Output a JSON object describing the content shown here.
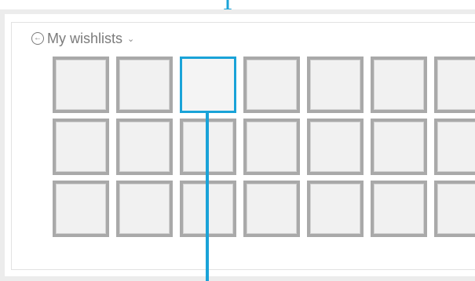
{
  "wishlists": {
    "back_icon": "circle-arrow-left-icon",
    "title": "My wishlists",
    "dropdown_icon": "chevron-down-icon"
  },
  "grid": {
    "rows": 3,
    "columns": 7,
    "selected": {
      "row": 1,
      "col": 3
    }
  },
  "colors": {
    "accent": "#1aa3d8",
    "tile_border": "#a9a9a9",
    "tile_fill": "#f1f1f1",
    "text": "#7b7b7b"
  }
}
